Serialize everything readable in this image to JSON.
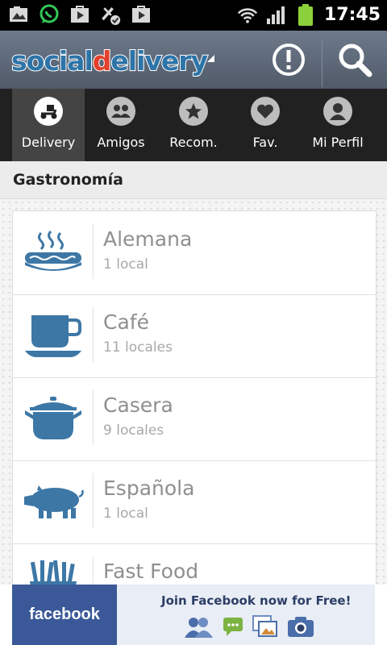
{
  "status_bar": {
    "time": "17:45",
    "icons": [
      "gallery-icon",
      "whatsapp-icon",
      "play-store-icon",
      "tools-icon",
      "download-icon",
      "wifi-icon",
      "signal-icon",
      "battery-icon"
    ]
  },
  "action_bar": {
    "logo_part1": "social",
    "logo_d": "d",
    "logo_part2": "elivery",
    "buttons": [
      "alert-icon",
      "search-icon"
    ]
  },
  "tabs": [
    {
      "label": "Delivery",
      "icon": "scooter-icon",
      "active": true
    },
    {
      "label": "Amigos",
      "icon": "friends-icon",
      "active": false
    },
    {
      "label": "Recom.",
      "icon": "star-icon",
      "active": false
    },
    {
      "label": "Fav.",
      "icon": "heart-icon",
      "active": false
    },
    {
      "label": "Mi Perfil",
      "icon": "profile-icon",
      "active": false
    }
  ],
  "section": {
    "title": "Gastronomía"
  },
  "categories": [
    {
      "name": "Alemana",
      "count": "1 local",
      "icon": "hotdog-icon"
    },
    {
      "name": "Café",
      "count": "11 locales",
      "icon": "coffee-cup-icon"
    },
    {
      "name": "Casera",
      "count": "9 locales",
      "icon": "cooking-pot-icon"
    },
    {
      "name": "Española",
      "count": "1 local",
      "icon": "pig-icon"
    },
    {
      "name": "Fast Food",
      "count": "",
      "icon": "fries-icon"
    }
  ],
  "ad": {
    "brand": "facebook",
    "text": "Join Facebook now for Free!"
  },
  "colors": {
    "icon_blue": "#3d77a6",
    "action_bar": "#5e6979",
    "tab_bar": "#212121"
  }
}
